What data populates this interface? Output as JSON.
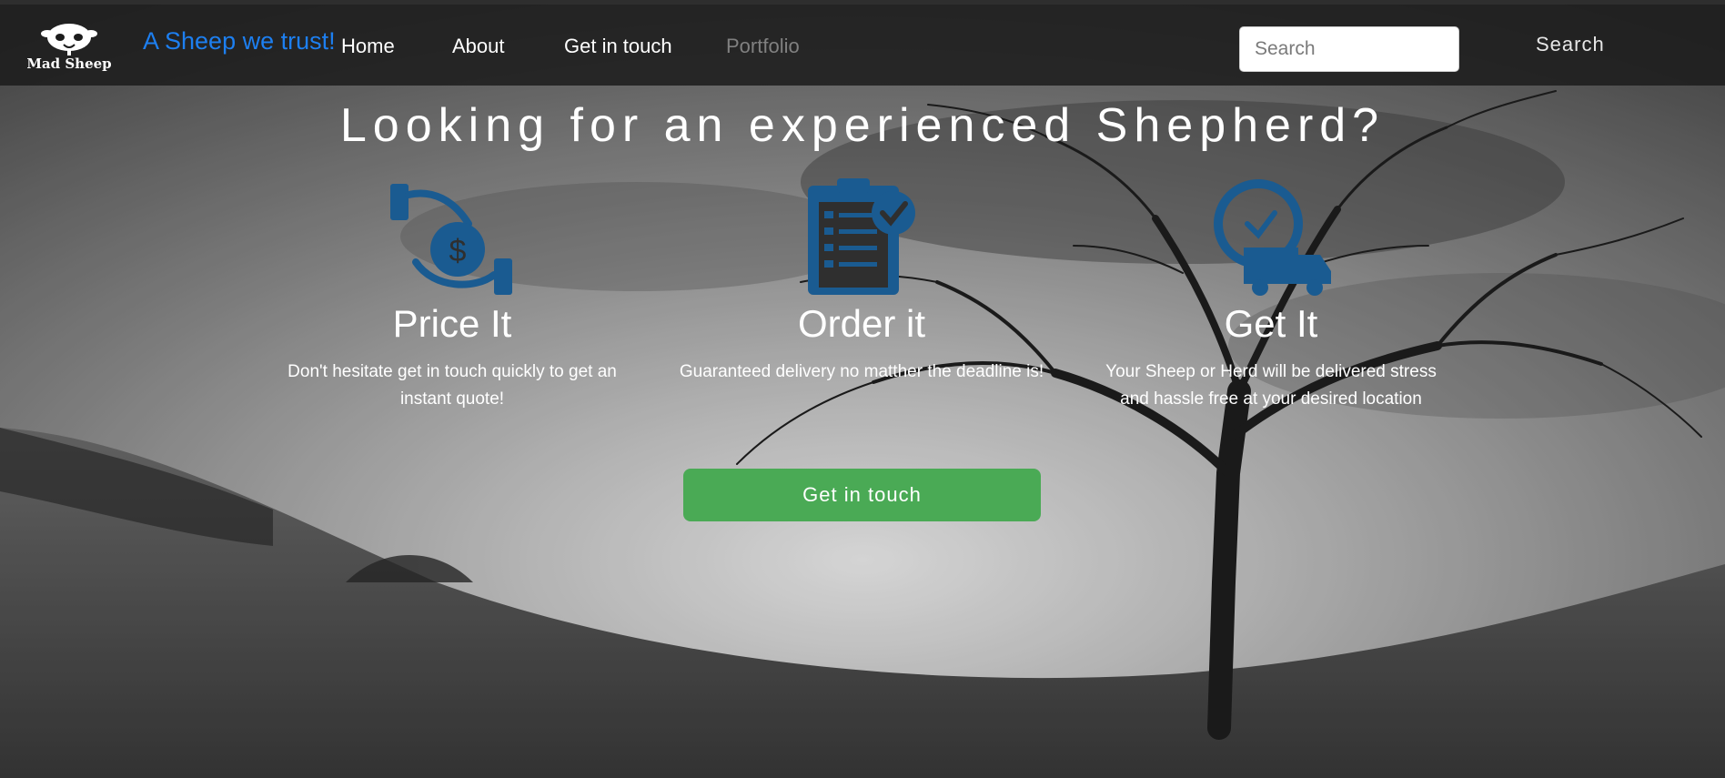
{
  "brand": {
    "logo_text": "Mad Sheep",
    "tagline": "A Sheep we trust!",
    "tagline_color": "#1d7ff0"
  },
  "nav": {
    "links": [
      {
        "label": "Home"
      },
      {
        "label": "About"
      },
      {
        "label": "Get in touch"
      },
      {
        "label": "Portfolio"
      }
    ]
  },
  "search": {
    "placeholder": "Search",
    "button_label": "Search"
  },
  "hero": {
    "title": "Looking for an experienced Shepherd?",
    "features": [
      {
        "icon": "hand-coin-icon",
        "title": "Price It",
        "text": "Don't hesitate get in touch quickly to get an instant quote!"
      },
      {
        "icon": "clipboard-check-icon",
        "title": "Order it",
        "text": "Guaranteed delivery no matther the deadline is!"
      },
      {
        "icon": "clock-truck-icon",
        "title": "Get It",
        "text": "Your Sheep or Herd will be delivered stress and hassle free at your desired location"
      }
    ],
    "icon_color": "#1a5b91",
    "cta_label": "Get in touch",
    "cta_color": "#4aaa55"
  }
}
